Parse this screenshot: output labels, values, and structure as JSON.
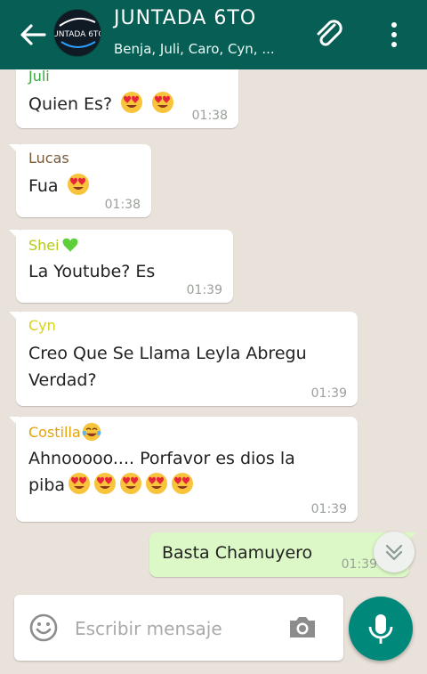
{
  "header": {
    "title": "JUNTADA 6TO",
    "subtitle": "Benja, Juli, Caro, Cyn, ...",
    "avatar_text": "JUNTADA 6TO"
  },
  "colors": {
    "header_bg": "#075e54",
    "chat_bg": "#e9e2da",
    "incoming_bubble": "#ffffff",
    "outgoing_bubble": "#dcf8c6",
    "mic_button": "#00897b",
    "sender_juli": "#3aa840",
    "sender_lucas": "#7a5a3a",
    "sender_shei": "#b6c91c",
    "sender_cyn": "#d8d21c",
    "sender_costilla": "#e5a20c"
  },
  "messages": [
    {
      "sender": "Juli",
      "text": "Quien Es?",
      "emojis": [
        "heart-eyes",
        "heart-eyes"
      ],
      "time": "01:38"
    },
    {
      "sender": "Lucas",
      "text": "Fua",
      "emojis": [
        "heart-eyes"
      ],
      "time": "01:38"
    },
    {
      "sender": "Shei",
      "sender_emoji": "green-heart",
      "text": "La Youtube? Es",
      "emojis": [],
      "time": "01:39"
    },
    {
      "sender": "Cyn",
      "text": "Creo Que Se Llama Leyla Abregu Verdad?",
      "emojis": [],
      "time": "01:39"
    },
    {
      "sender": "Costilla",
      "sender_emoji": "tears-of-joy",
      "text_line1": "Ahnooooo.... Porfavor es dios la",
      "text_line2": "piba",
      "emojis": [
        "heart-eyes",
        "heart-eyes",
        "heart-eyes",
        "heart-eyes",
        "heart-eyes"
      ],
      "time": "01:39"
    },
    {
      "outgoing": true,
      "text": "Basta Chamuyero",
      "time": "01:39"
    }
  ],
  "composer": {
    "placeholder": "Escribir mensaje"
  },
  "icons": [
    "back-arrow-icon",
    "attach-clip-icon",
    "more-vert-icon",
    "scroll-down-icon",
    "smiley-icon",
    "camera-icon",
    "mic-icon"
  ]
}
